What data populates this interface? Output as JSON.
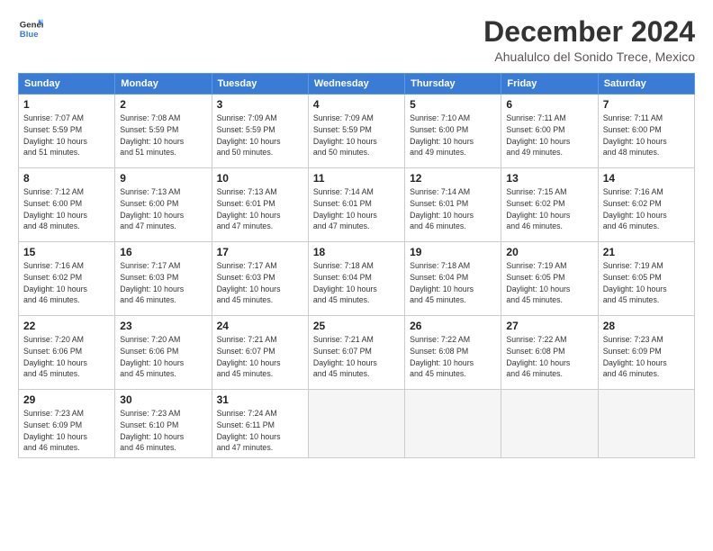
{
  "logo": {
    "line1": "General",
    "line2": "Blue"
  },
  "title": "December 2024",
  "location": "Ahualulco del Sonido Trece, Mexico",
  "days_of_week": [
    "Sunday",
    "Monday",
    "Tuesday",
    "Wednesday",
    "Thursday",
    "Friday",
    "Saturday"
  ],
  "weeks": [
    [
      {
        "day": "1",
        "info": "Sunrise: 7:07 AM\nSunset: 5:59 PM\nDaylight: 10 hours\nand 51 minutes."
      },
      {
        "day": "2",
        "info": "Sunrise: 7:08 AM\nSunset: 5:59 PM\nDaylight: 10 hours\nand 51 minutes."
      },
      {
        "day": "3",
        "info": "Sunrise: 7:09 AM\nSunset: 5:59 PM\nDaylight: 10 hours\nand 50 minutes."
      },
      {
        "day": "4",
        "info": "Sunrise: 7:09 AM\nSunset: 5:59 PM\nDaylight: 10 hours\nand 50 minutes."
      },
      {
        "day": "5",
        "info": "Sunrise: 7:10 AM\nSunset: 6:00 PM\nDaylight: 10 hours\nand 49 minutes."
      },
      {
        "day": "6",
        "info": "Sunrise: 7:11 AM\nSunset: 6:00 PM\nDaylight: 10 hours\nand 49 minutes."
      },
      {
        "day": "7",
        "info": "Sunrise: 7:11 AM\nSunset: 6:00 PM\nDaylight: 10 hours\nand 48 minutes."
      }
    ],
    [
      {
        "day": "8",
        "info": "Sunrise: 7:12 AM\nSunset: 6:00 PM\nDaylight: 10 hours\nand 48 minutes."
      },
      {
        "day": "9",
        "info": "Sunrise: 7:13 AM\nSunset: 6:00 PM\nDaylight: 10 hours\nand 47 minutes."
      },
      {
        "day": "10",
        "info": "Sunrise: 7:13 AM\nSunset: 6:01 PM\nDaylight: 10 hours\nand 47 minutes."
      },
      {
        "day": "11",
        "info": "Sunrise: 7:14 AM\nSunset: 6:01 PM\nDaylight: 10 hours\nand 47 minutes."
      },
      {
        "day": "12",
        "info": "Sunrise: 7:14 AM\nSunset: 6:01 PM\nDaylight: 10 hours\nand 46 minutes."
      },
      {
        "day": "13",
        "info": "Sunrise: 7:15 AM\nSunset: 6:02 PM\nDaylight: 10 hours\nand 46 minutes."
      },
      {
        "day": "14",
        "info": "Sunrise: 7:16 AM\nSunset: 6:02 PM\nDaylight: 10 hours\nand 46 minutes."
      }
    ],
    [
      {
        "day": "15",
        "info": "Sunrise: 7:16 AM\nSunset: 6:02 PM\nDaylight: 10 hours\nand 46 minutes."
      },
      {
        "day": "16",
        "info": "Sunrise: 7:17 AM\nSunset: 6:03 PM\nDaylight: 10 hours\nand 46 minutes."
      },
      {
        "day": "17",
        "info": "Sunrise: 7:17 AM\nSunset: 6:03 PM\nDaylight: 10 hours\nand 45 minutes."
      },
      {
        "day": "18",
        "info": "Sunrise: 7:18 AM\nSunset: 6:04 PM\nDaylight: 10 hours\nand 45 minutes."
      },
      {
        "day": "19",
        "info": "Sunrise: 7:18 AM\nSunset: 6:04 PM\nDaylight: 10 hours\nand 45 minutes."
      },
      {
        "day": "20",
        "info": "Sunrise: 7:19 AM\nSunset: 6:05 PM\nDaylight: 10 hours\nand 45 minutes."
      },
      {
        "day": "21",
        "info": "Sunrise: 7:19 AM\nSunset: 6:05 PM\nDaylight: 10 hours\nand 45 minutes."
      }
    ],
    [
      {
        "day": "22",
        "info": "Sunrise: 7:20 AM\nSunset: 6:06 PM\nDaylight: 10 hours\nand 45 minutes."
      },
      {
        "day": "23",
        "info": "Sunrise: 7:20 AM\nSunset: 6:06 PM\nDaylight: 10 hours\nand 45 minutes."
      },
      {
        "day": "24",
        "info": "Sunrise: 7:21 AM\nSunset: 6:07 PM\nDaylight: 10 hours\nand 45 minutes."
      },
      {
        "day": "25",
        "info": "Sunrise: 7:21 AM\nSunset: 6:07 PM\nDaylight: 10 hours\nand 45 minutes."
      },
      {
        "day": "26",
        "info": "Sunrise: 7:22 AM\nSunset: 6:08 PM\nDaylight: 10 hours\nand 45 minutes."
      },
      {
        "day": "27",
        "info": "Sunrise: 7:22 AM\nSunset: 6:08 PM\nDaylight: 10 hours\nand 46 minutes."
      },
      {
        "day": "28",
        "info": "Sunrise: 7:23 AM\nSunset: 6:09 PM\nDaylight: 10 hours\nand 46 minutes."
      }
    ],
    [
      {
        "day": "29",
        "info": "Sunrise: 7:23 AM\nSunset: 6:09 PM\nDaylight: 10 hours\nand 46 minutes."
      },
      {
        "day": "30",
        "info": "Sunrise: 7:23 AM\nSunset: 6:10 PM\nDaylight: 10 hours\nand 46 minutes."
      },
      {
        "day": "31",
        "info": "Sunrise: 7:24 AM\nSunset: 6:11 PM\nDaylight: 10 hours\nand 47 minutes."
      },
      {
        "day": "",
        "info": ""
      },
      {
        "day": "",
        "info": ""
      },
      {
        "day": "",
        "info": ""
      },
      {
        "day": "",
        "info": ""
      }
    ]
  ]
}
